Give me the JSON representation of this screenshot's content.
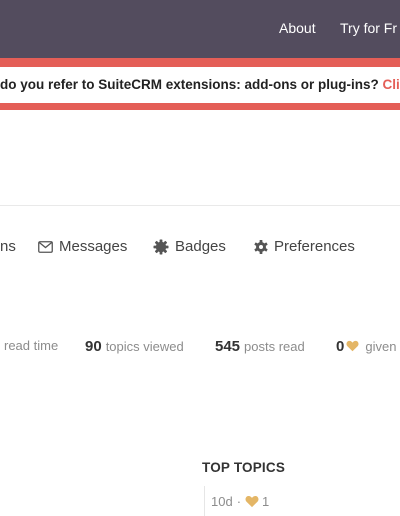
{
  "header": {
    "nav": {
      "about": "About",
      "try_free": "Try for Fr"
    }
  },
  "banner": {
    "text": "do you refer to SuiteCRM extensions: add-ons or plug-ins?",
    "link": "Clic"
  },
  "user_nav": {
    "partial_tab": "ns",
    "messages": "Messages",
    "badges": "Badges",
    "preferences": "Preferences"
  },
  "stats": {
    "read_time_label": "read time",
    "topics_viewed_value": "90",
    "topics_viewed_label": "topics viewed",
    "posts_read_value": "545",
    "posts_read_label": "posts read",
    "likes_given_value": "0",
    "likes_given_label": "given"
  },
  "top_topics": {
    "heading": "TOP TOPICS",
    "items": [
      {
        "age": "10d",
        "likes": "1"
      }
    ]
  },
  "colors": {
    "header_bg": "#534c5e",
    "accent": "#e45e57",
    "heart": "#e4b666"
  },
  "icons": {
    "messages": "envelope-icon",
    "badges": "badge-icon",
    "preferences": "gear-icon",
    "like": "heart-icon"
  }
}
